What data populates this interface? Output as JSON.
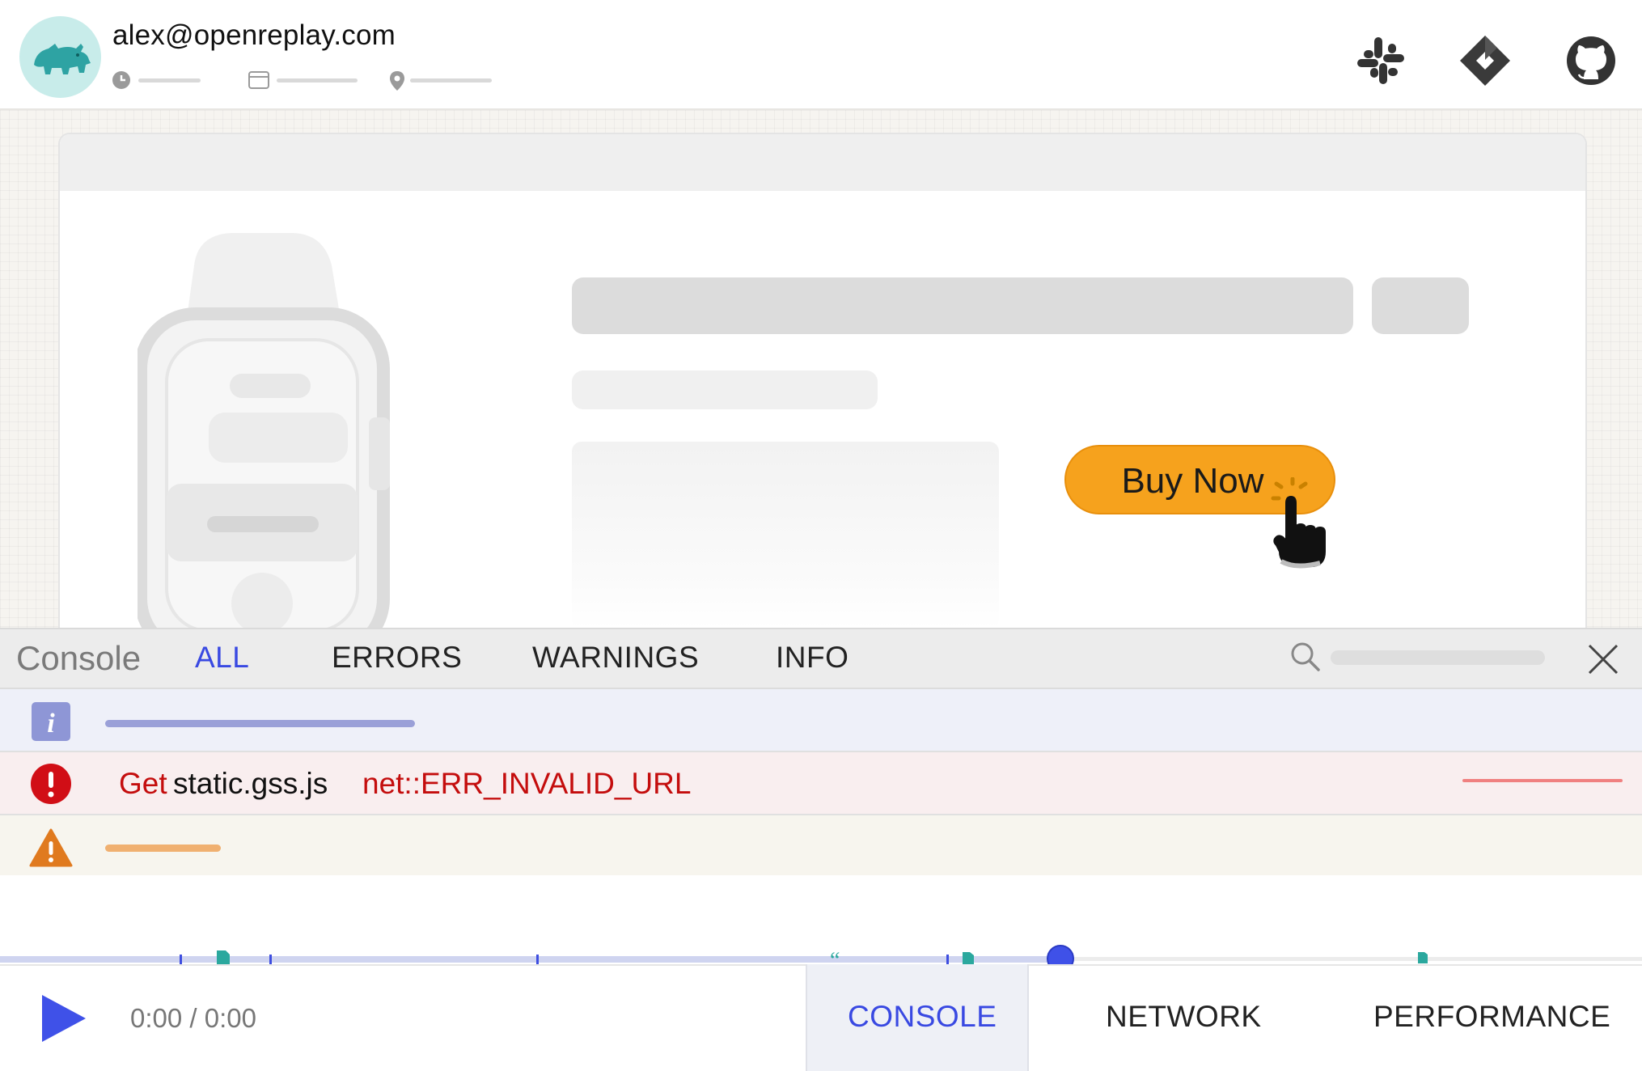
{
  "header": {
    "email": "alex@openreplay.com",
    "meta_icons": [
      "clock-icon",
      "browser-window-icon",
      "location-pin-icon"
    ],
    "integration_icons": [
      "slack-icon",
      "jira-icon",
      "github-icon"
    ]
  },
  "preview": {
    "buy_button_label": "Buy Now"
  },
  "console": {
    "title": "Console",
    "tabs": [
      {
        "label": "ALL",
        "active": true
      },
      {
        "label": "ERRORS",
        "active": false
      },
      {
        "label": "WARNINGS",
        "active": false
      },
      {
        "label": "INFO",
        "active": false
      }
    ],
    "rows": [
      {
        "type": "info",
        "icon": "info-icon"
      },
      {
        "type": "error",
        "icon": "error-icon",
        "method": "Get",
        "file": "static.gss.js",
        "message": "net::ERR_INVALID_URL"
      },
      {
        "type": "warning",
        "icon": "warning-icon"
      }
    ]
  },
  "player": {
    "time": "0:00 / 0:00",
    "tabs": [
      {
        "label": "CONSOLE",
        "active": true
      },
      {
        "label": "NETWORK",
        "active": false
      },
      {
        "label": "PERFORMANCE",
        "active": false
      }
    ]
  },
  "colors": {
    "accent": "#3949e2",
    "buy_button": "#f6a21d",
    "error_text": "#c40d0d",
    "warning": "#e07a1f"
  }
}
